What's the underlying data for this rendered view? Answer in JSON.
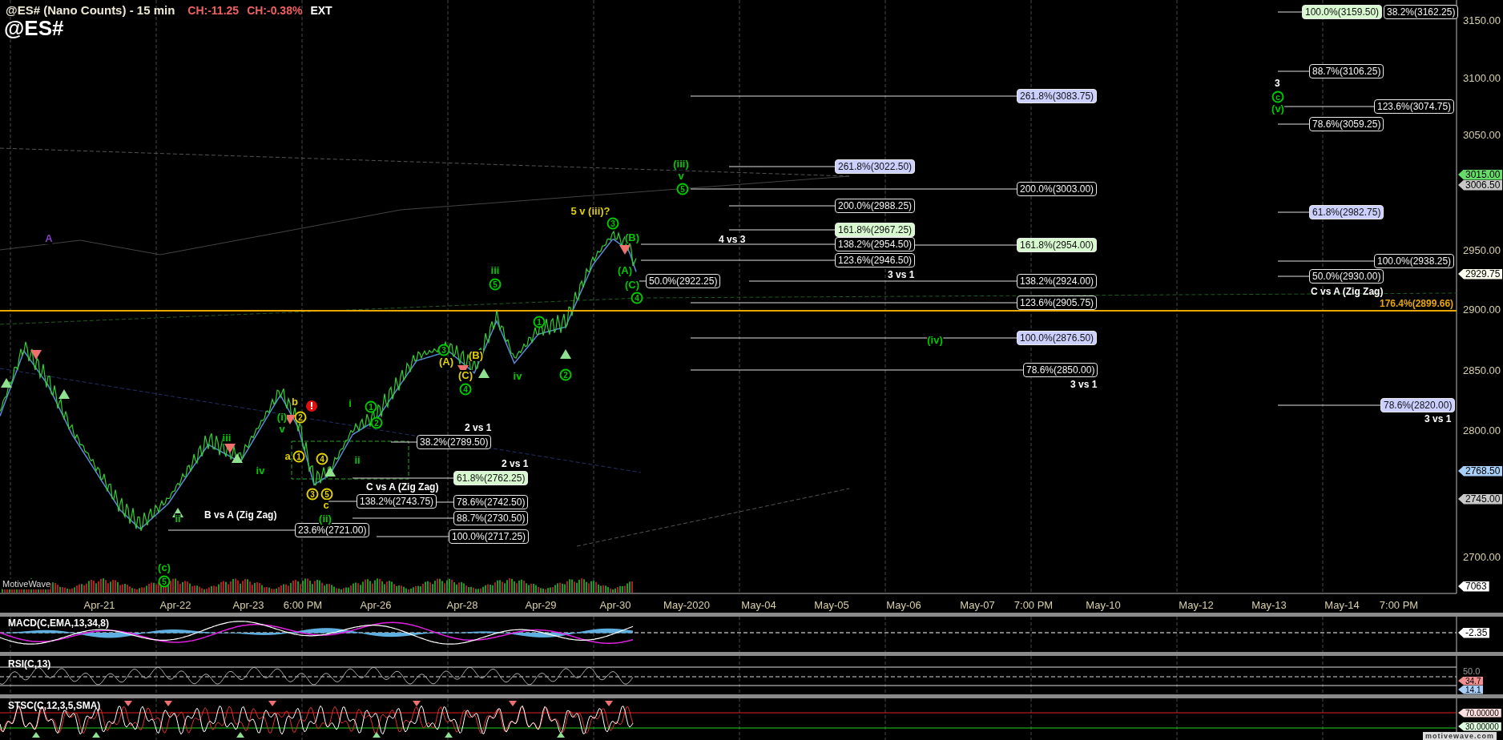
{
  "header": {
    "title": "@ES# (Nano Counts) - 15 min",
    "change": "CH:-11.25",
    "change_percent": "CH:-0.38%",
    "session": "EXT",
    "symbol": "@ES#"
  },
  "price_chart": {
    "price_axis": [
      "3150.00",
      "3100.00",
      "3050.00",
      "2950.00",
      "2900.00",
      "2850.00",
      "2800.00",
      "2700.00"
    ],
    "price_tags": [
      {
        "text": "3015.00",
        "color": "#66dd66"
      },
      {
        "text": "3006.50",
        "color": "#c8c8c8"
      },
      {
        "text": "2929.75",
        "color": "#fffff0"
      },
      {
        "text": "2768.50",
        "color": "#a8d0f8"
      },
      {
        "text": "2745.00",
        "color": "#c8c8c8"
      },
      {
        "text": "7063",
        "color": "#ffffff"
      }
    ],
    "fib_levels": [
      {
        "text": "100.0%(3159.50)",
        "color": "#d8f8d0"
      },
      {
        "text": "38.2%(3162.25)",
        "color": "#000000"
      },
      {
        "text": "88.7%(3106.25)",
        "color": "#000000"
      },
      {
        "text": "261.8%(3083.75)",
        "color": "#ccd0ff"
      },
      {
        "text": "123.6%(3074.75)",
        "color": "#000000"
      },
      {
        "text": "78.6%(3059.25)",
        "color": "#000000"
      },
      {
        "text": "261.8%(3022.50)",
        "color": "#ccd0ff"
      },
      {
        "text": "200.0%(3003.00)",
        "color": "#000000"
      },
      {
        "text": "200.0%(2988.25)",
        "color": "#000000"
      },
      {
        "text": "61.8%(2982.75)",
        "color": "#ccd0ff"
      },
      {
        "text": "161.8%(2967.25)",
        "color": "#d8f8d0"
      },
      {
        "text": "138.2%(2954.50)",
        "color": "#000000"
      },
      {
        "text": "161.8%(2954.00)",
        "color": "#d8f8d0"
      },
      {
        "text": "123.6%(2946.50)",
        "color": "#000000"
      },
      {
        "text": "100.0%(2938.25)",
        "color": "#000000"
      },
      {
        "text": "50.0%(2930.00)",
        "color": "#000000"
      },
      {
        "text": "50.0%(2922.25)",
        "color": "#000000"
      },
      {
        "text": "138.2%(2924.00)",
        "color": "#000000"
      },
      {
        "text": "123.6%(2905.75)",
        "color": "#000000"
      },
      {
        "text": "100.0%(2876.50)",
        "color": "#ccd0ff"
      },
      {
        "text": "78.6%(2850.00)",
        "color": "#000000"
      },
      {
        "text": "78.6%(2820.00)",
        "color": "#ccd0ff"
      },
      {
        "text": "38.2%(2789.50)",
        "color": "#000000"
      },
      {
        "text": "61.8%(2762.25)",
        "color": "#d8f8d0"
      },
      {
        "text": "138.2%(2743.75)",
        "color": "#000000"
      },
      {
        "text": "78.6%(2742.50)",
        "color": "#000000"
      },
      {
        "text": "88.7%(2730.50)",
        "color": "#000000"
      },
      {
        "text": "23.6%(2721.00)",
        "color": "#000000"
      },
      {
        "text": "100.0%(2717.25)",
        "color": "#000000"
      }
    ],
    "reference_level": {
      "text": "176.4%(2899.66)",
      "color": "#e8a800"
    },
    "notes": [
      "3",
      "4 vs 3",
      "3 vs 1",
      "C vs A (Zig Zag)",
      "3 vs 1",
      "3 vs 1",
      "2 vs 1",
      "2 vs 1",
      "C vs A (Zig Zag)",
      "B vs A (Zig Zag)"
    ],
    "wave_labels": [
      {
        "text": "c",
        "color": "#00c800",
        "circled": true
      },
      {
        "text": "(v)",
        "color": "#00c800",
        "circled": false
      },
      {
        "text": "(iii)",
        "color": "#00c800",
        "circled": false
      },
      {
        "text": "v",
        "color": "#00c800",
        "circled": false
      },
      {
        "text": "5",
        "color": "#00c800",
        "circled": true
      },
      {
        "text": "5 v (iii)?",
        "color": "#e0d000",
        "circled": false
      },
      {
        "text": "3",
        "color": "#00c800",
        "circled": true
      },
      {
        "text": "A",
        "color": "#8040c0",
        "circled": false
      },
      {
        "text": "(B)",
        "color": "#00c800",
        "circled": false
      },
      {
        "text": "iii",
        "color": "#00c800",
        "circled": false
      },
      {
        "text": "(A)",
        "color": "#00c800",
        "circled": false
      },
      {
        "text": "5",
        "color": "#00c800",
        "circled": true
      },
      {
        "text": "(C)",
        "color": "#00c800",
        "circled": false
      },
      {
        "text": "4",
        "color": "#00c800",
        "circled": true
      },
      {
        "text": "1",
        "color": "#00c800",
        "circled": true
      },
      {
        "text": "(iv)",
        "color": "#00c800",
        "circled": false
      },
      {
        "text": "3",
        "color": "#00c800",
        "circled": true
      },
      {
        "text": "(A)",
        "color": "#e0d000",
        "circled": false
      },
      {
        "text": "(B)",
        "color": "#e0d000",
        "circled": false
      },
      {
        "text": "(C)",
        "color": "#e0d000",
        "circled": false
      },
      {
        "text": "iv",
        "color": "#00c800",
        "circled": false
      },
      {
        "text": "2",
        "color": "#00c800",
        "circled": true
      },
      {
        "text": "4",
        "color": "#00c800",
        "circled": true
      },
      {
        "text": "b",
        "color": "#e0d000",
        "circled": false
      },
      {
        "text": "i",
        "color": "#00c800",
        "circled": false
      },
      {
        "text": "1",
        "color": "#00c800",
        "circled": true
      },
      {
        "text": "(i)",
        "color": "#00c800",
        "circled": false
      },
      {
        "text": "2",
        "color": "#e0d000",
        "circled": true
      },
      {
        "text": "2",
        "color": "#00c800",
        "circled": true
      },
      {
        "text": "v",
        "color": "#00c800",
        "circled": false
      },
      {
        "text": "iii",
        "color": "#00c800",
        "circled": false
      },
      {
        "text": "a",
        "color": "#e0d000",
        "circled": false
      },
      {
        "text": "1",
        "color": "#e0d000",
        "circled": true
      },
      {
        "text": "4",
        "color": "#e0d000",
        "circled": true
      },
      {
        "text": "ii",
        "color": "#00c800",
        "circled": false
      },
      {
        "text": "iv",
        "color": "#00c800",
        "circled": false
      },
      {
        "text": "3",
        "color": "#e0d000",
        "circled": true
      },
      {
        "text": "5",
        "color": "#e0d000",
        "circled": true
      },
      {
        "text": "c",
        "color": "#e0d000",
        "circled": false
      },
      {
        "text": "ii",
        "color": "#00c800",
        "circled": false
      },
      {
        "text": "(ii)",
        "color": "#00c800",
        "circled": false
      },
      {
        "text": "(c)",
        "color": "#00c800",
        "circled": false
      },
      {
        "text": "5",
        "color": "#00c800",
        "circled": true
      }
    ],
    "volume_label": "MotiveWave"
  },
  "time_axis": [
    "Apr-21",
    "Apr-22",
    "Apr-23",
    "6:00 PM",
    "Apr-26",
    "Apr-28",
    "Apr-29",
    "Apr-30",
    "May-2020",
    "May-04",
    "May-05",
    "May-06",
    "May-07",
    "7:00 PM",
    "May-10",
    "May-12",
    "May-13",
    "May-14",
    "7:00 PM"
  ],
  "macd": {
    "title": "MACD(C,EMA,13,34,8)",
    "tags": [
      {
        "text": "-2.35",
        "color": "#ffffff"
      }
    ]
  },
  "rsi": {
    "title": "RSI(C,13)",
    "axis": "50.0",
    "tags": [
      {
        "text": "34.7",
        "color": "#f09090"
      },
      {
        "text": "14.1",
        "color": "#a8d0f8"
      }
    ]
  },
  "stsc": {
    "title": "STSC(C,12,3,5,SMA)",
    "tags": [
      {
        "text": "70.00000",
        "color": "#ffe0e0"
      },
      {
        "text": "30.00000",
        "color": "#e0ffe0"
      }
    ]
  },
  "footer": "motivewave.com"
}
